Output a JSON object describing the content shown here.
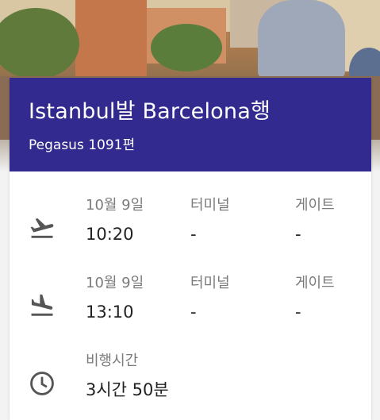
{
  "flight": {
    "title": "Istanbul발 Barcelona행",
    "subtitle": "Pegasus 1091편"
  },
  "departure": {
    "icon": "takeoff-icon",
    "date": "10월 9일",
    "time": "10:20",
    "terminal_label": "터미널",
    "terminal_value": "-",
    "gate_label": "게이트",
    "gate_value": "-"
  },
  "arrival": {
    "icon": "landing-icon",
    "date": "10월 9일",
    "time": "13:10",
    "terminal_label": "터미널",
    "terminal_value": "-",
    "gate_label": "게이트",
    "gate_value": "-"
  },
  "duration": {
    "icon": "clock-icon",
    "label": "비행시간",
    "value": "3시간 50분"
  },
  "colors": {
    "header_bg": "#322a8e",
    "header_text": "#ffffff",
    "label_text": "#7b7b7b",
    "value_text": "#222222"
  }
}
